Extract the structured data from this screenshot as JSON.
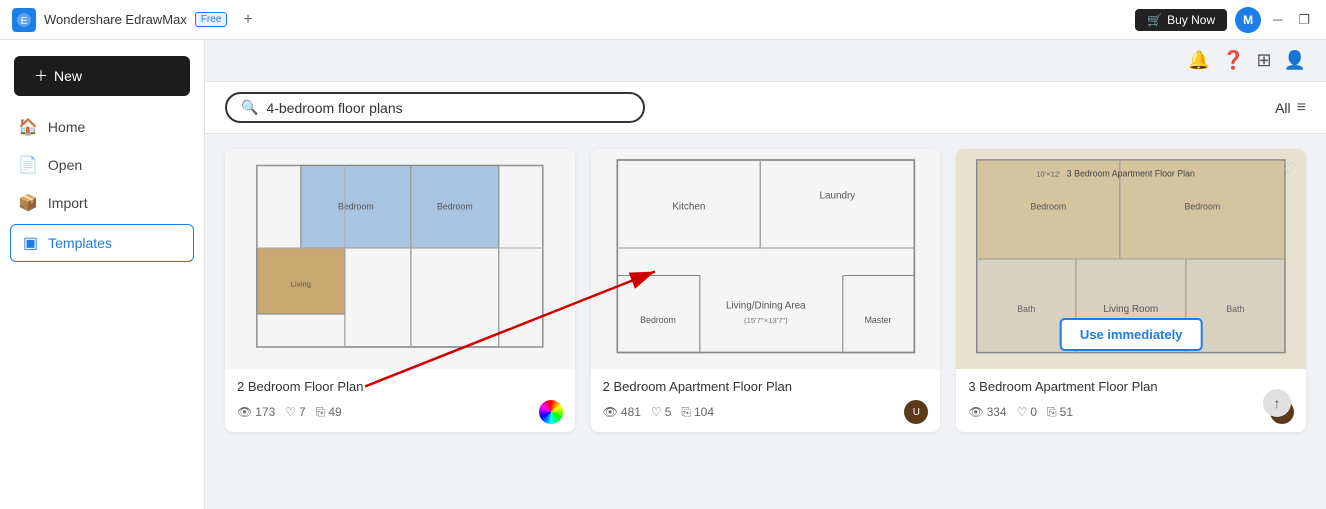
{
  "titleBar": {
    "appName": "Wondershare EdrawMax",
    "freeBadge": "Free",
    "addTab": "+",
    "buyNow": "Buy Now",
    "userInitial": "M",
    "minimize": "─",
    "restore": "❐"
  },
  "sidebar": {
    "newButton": "New",
    "items": [
      {
        "id": "home",
        "label": "Home",
        "icon": "🏠"
      },
      {
        "id": "open",
        "label": "Open",
        "icon": "📄"
      },
      {
        "id": "import",
        "label": "Import",
        "icon": "📦"
      },
      {
        "id": "templates",
        "label": "Templates",
        "icon": "▣"
      }
    ]
  },
  "topBar": {
    "bellIcon": "🔔",
    "questionIcon": "❓",
    "gridIcon": "⊞",
    "userIcon": "👤"
  },
  "search": {
    "placeholder": "4-bedroom floor plans",
    "filterLabel": "All",
    "filterIcon": "≡"
  },
  "cards": [
    {
      "id": "card1",
      "title": "2 Bedroom Floor Plan",
      "views": "173",
      "likes": "7",
      "copies": "49",
      "hasColorDot": true,
      "avatarColor": "#e8784a"
    },
    {
      "id": "card2",
      "title": "2 Bedroom Apartment Floor Plan",
      "views": "481",
      "likes": "5",
      "copies": "104",
      "hasColorDot": false,
      "avatarColor": "#5a3a1a"
    },
    {
      "id": "card3",
      "title": "3 Bedroom Apartment Floor Plan",
      "views": "334",
      "likes": "0",
      "copies": "51",
      "useImmediately": true,
      "hasColorDot": false,
      "avatarColor": "#5a3a1a"
    }
  ],
  "useImmediatelyLabel": "Use immediately"
}
